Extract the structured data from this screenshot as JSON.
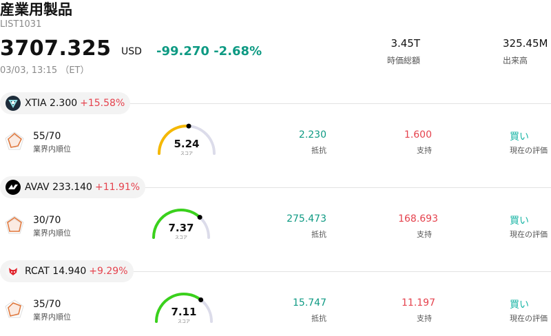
{
  "header": {
    "title": "産業用製品",
    "code": "LIST1031",
    "price": "3707.325",
    "currency": "USD",
    "change": "-99.270 -2.68%",
    "time": "03/03, 13:15 （ET）",
    "market_cap_value": "3.45T",
    "market_cap_label": "時価総額",
    "volume_value": "325.45M",
    "volume_label": "出来高"
  },
  "stocks": [
    {
      "ticker_price": "XTIA 2.300",
      "change": "+15.58%",
      "rank": "55/70",
      "rank_label": "業界内順位",
      "score": "5.24",
      "score_value": 5.24,
      "score_label": "スコア",
      "resistance": "2.230",
      "resistance_label": "抵抗",
      "support": "1.600",
      "support_label": "支持",
      "rating": "買い",
      "rating_label": "現在の評価",
      "gauge_color": "#f5b800",
      "logo_icon": "xtia-logo-icon"
    },
    {
      "ticker_price": "AVAV 233.140",
      "change": "+11.91%",
      "rank": "30/70",
      "rank_label": "業界内順位",
      "score": "7.37",
      "score_value": 7.37,
      "score_label": "スコア",
      "resistance": "275.473",
      "resistance_label": "抵抗",
      "support": "168.693",
      "support_label": "支持",
      "rating": "買い",
      "rating_label": "現在の評価",
      "gauge_color": "#3ad11c",
      "logo_icon": "avav-logo-icon"
    },
    {
      "ticker_price": "RCAT 14.940",
      "change": "+9.29%",
      "rank": "35/70",
      "rank_label": "業界内順位",
      "score": "7.11",
      "score_value": 7.11,
      "score_label": "スコア",
      "resistance": "15.747",
      "resistance_label": "抵抗",
      "support": "11.197",
      "support_label": "支持",
      "rating": "買い",
      "rating_label": "現在の評価",
      "gauge_color": "#3ad11c",
      "logo_icon": "rcat-logo-icon"
    }
  ],
  "colors": {
    "negative": "#0e9a83",
    "positive": "#e5424d",
    "buy": "#19b5a5"
  }
}
